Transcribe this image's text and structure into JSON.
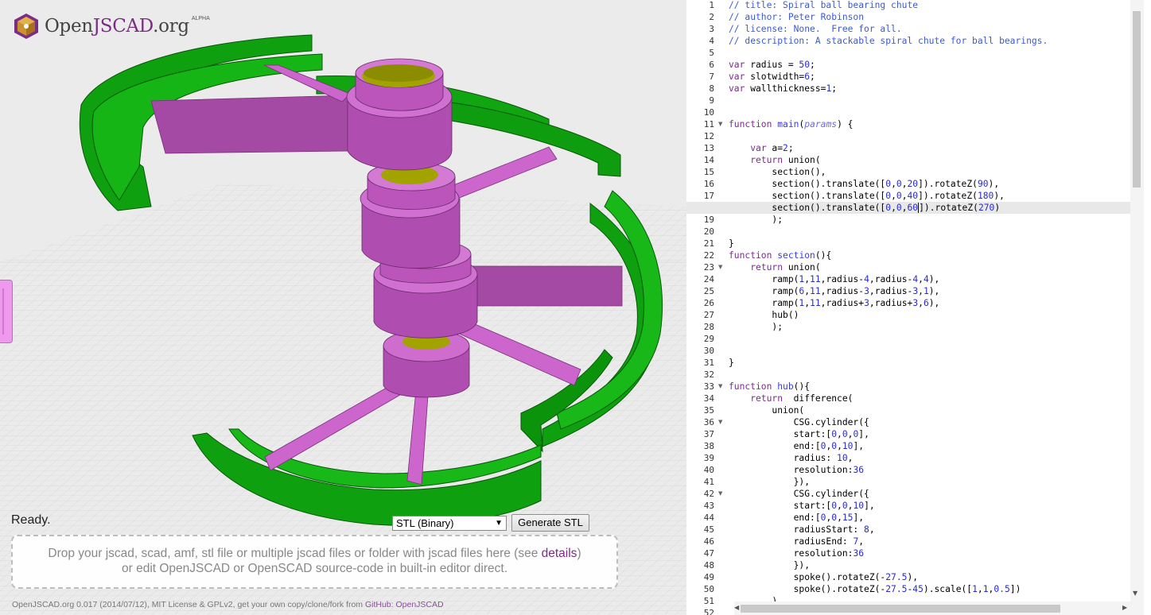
{
  "app": {
    "brand_open": "Open",
    "brand_accent": "JSCAD",
    "brand_tld": ".org",
    "badge": "ALPHA"
  },
  "viewport": {
    "status": "Ready.",
    "format_select": {
      "selected": "STL (Binary)"
    },
    "generate_button": "Generate STL",
    "dropzone": {
      "line1_before": "Drop your jscad, scad, amf, stl file or multiple jscad files or folder with jscad files here (see ",
      "line1_link": "details",
      "line1_after": ")",
      "line2": "or edit OpenJSCAD or OpenSCAD source-code in built-in editor direct."
    },
    "footer": {
      "text": "OpenJSCAD.org 0.017 (2014/07/12), MIT License & GPLv2, get your own copy/clone/fork from ",
      "link1": "GitHub: OpenJSCAD",
      "link_separator": ": "
    },
    "colors": {
      "ring": "#11a011",
      "spokes": "#cc66cc",
      "hub": "#b04db0",
      "bore": "#9b9b00",
      "grid": "#d6d6d6"
    }
  },
  "editor": {
    "active_line": 18,
    "folded_lines": [
      11,
      23,
      33,
      36,
      42
    ],
    "lines": [
      [
        [
          "cm",
          "// title: Spiral ball bearing chute"
        ]
      ],
      [
        [
          "cm",
          "// author: Peter Robinson"
        ]
      ],
      [
        [
          "cm",
          "// license: None.  Free for all."
        ]
      ],
      [
        [
          "cm",
          "// description: A stackable spiral chute for ball bearings."
        ]
      ],
      [],
      [
        [
          "kw",
          "var"
        ],
        [
          "t",
          " radius = "
        ],
        [
          "nm",
          "50"
        ],
        [
          "t",
          ";"
        ]
      ],
      [
        [
          "kw",
          "var"
        ],
        [
          "t",
          " slotwidth="
        ],
        [
          "nm",
          "6"
        ],
        [
          "t",
          ";"
        ]
      ],
      [
        [
          "kw",
          "var"
        ],
        [
          "t",
          " wallthickness="
        ],
        [
          "nm",
          "1"
        ],
        [
          "t",
          ";"
        ]
      ],
      [],
      [],
      [
        [
          "kw",
          "function"
        ],
        [
          "t",
          " "
        ],
        [
          "fn",
          "main"
        ],
        [
          "t",
          "("
        ],
        [
          "pr",
          "params"
        ],
        [
          "t",
          ") {"
        ]
      ],
      [],
      [
        [
          "t",
          "    "
        ],
        [
          "kw",
          "var"
        ],
        [
          "t",
          " a="
        ],
        [
          "nm",
          "2"
        ],
        [
          "t",
          ";"
        ]
      ],
      [
        [
          "t",
          "    "
        ],
        [
          "kw",
          "return"
        ],
        [
          "t",
          " union("
        ]
      ],
      [
        [
          "t",
          "        section(),"
        ]
      ],
      [
        [
          "t",
          "        section().translate(["
        ],
        [
          "nm",
          "0"
        ],
        [
          "t",
          ","
        ],
        [
          "nm",
          "0"
        ],
        [
          "t",
          ","
        ],
        [
          "nm",
          "20"
        ],
        [
          "t",
          "]).rotateZ("
        ],
        [
          "nm",
          "90"
        ],
        [
          "t",
          "),"
        ]
      ],
      [
        [
          "t",
          "        section().translate(["
        ],
        [
          "nm",
          "0"
        ],
        [
          "t",
          ","
        ],
        [
          "nm",
          "0"
        ],
        [
          "t",
          ","
        ],
        [
          "nm",
          "40"
        ],
        [
          "t",
          "]).rotateZ("
        ],
        [
          "nm",
          "180"
        ],
        [
          "t",
          "),"
        ]
      ],
      [
        [
          "t",
          "        section().translate(["
        ],
        [
          "nm",
          "0"
        ],
        [
          "t",
          ","
        ],
        [
          "nm",
          "0"
        ],
        [
          "t",
          ","
        ],
        [
          "nm",
          "60"
        ],
        [
          "c",
          ""
        ],
        [
          "t",
          "]).rotateZ("
        ],
        [
          "nm",
          "270"
        ],
        [
          "t",
          ")"
        ]
      ],
      [
        [
          "t",
          "        );"
        ]
      ],
      [],
      [
        [
          "t",
          "}"
        ]
      ],
      [
        [
          "kw",
          "function"
        ],
        [
          "t",
          " "
        ],
        [
          "fn",
          "section"
        ],
        [
          "t",
          "(){"
        ]
      ],
      [
        [
          "t",
          "    "
        ],
        [
          "kw",
          "return"
        ],
        [
          "t",
          " union("
        ]
      ],
      [
        [
          "t",
          "        ramp("
        ],
        [
          "nm",
          "1"
        ],
        [
          "t",
          ","
        ],
        [
          "nm",
          "11"
        ],
        [
          "t",
          ",radius-"
        ],
        [
          "nm",
          "4"
        ],
        [
          "t",
          ",radius-"
        ],
        [
          "nm",
          "4"
        ],
        [
          "t",
          ","
        ],
        [
          "nm",
          "4"
        ],
        [
          "t",
          "),"
        ]
      ],
      [
        [
          "t",
          "        ramp("
        ],
        [
          "nm",
          "6"
        ],
        [
          "t",
          ","
        ],
        [
          "nm",
          "11"
        ],
        [
          "t",
          ",radius-"
        ],
        [
          "nm",
          "3"
        ],
        [
          "t",
          ",radius-"
        ],
        [
          "nm",
          "3"
        ],
        [
          "t",
          ","
        ],
        [
          "nm",
          "1"
        ],
        [
          "t",
          "),"
        ]
      ],
      [
        [
          "t",
          "        ramp("
        ],
        [
          "nm",
          "1"
        ],
        [
          "t",
          ","
        ],
        [
          "nm",
          "11"
        ],
        [
          "t",
          ",radius+"
        ],
        [
          "nm",
          "3"
        ],
        [
          "t",
          ",radius+"
        ],
        [
          "nm",
          "3"
        ],
        [
          "t",
          ","
        ],
        [
          "nm",
          "6"
        ],
        [
          "t",
          "),"
        ]
      ],
      [
        [
          "t",
          "        hub()"
        ]
      ],
      [
        [
          "t",
          "        );"
        ]
      ],
      [],
      [],
      [
        [
          "t",
          "}"
        ]
      ],
      [],
      [
        [
          "kw",
          "function"
        ],
        [
          "t",
          " "
        ],
        [
          "fn",
          "hub"
        ],
        [
          "t",
          "(){"
        ]
      ],
      [
        [
          "t",
          "    "
        ],
        [
          "kw",
          "return"
        ],
        [
          "t",
          "  difference("
        ]
      ],
      [
        [
          "t",
          "        union("
        ]
      ],
      [
        [
          "t",
          "            CSG.cylinder({"
        ]
      ],
      [
        [
          "t",
          "            start:["
        ],
        [
          "nm",
          "0"
        ],
        [
          "t",
          ","
        ],
        [
          "nm",
          "0"
        ],
        [
          "t",
          ","
        ],
        [
          "nm",
          "0"
        ],
        [
          "t",
          "],"
        ]
      ],
      [
        [
          "t",
          "            end:["
        ],
        [
          "nm",
          "0"
        ],
        [
          "t",
          ","
        ],
        [
          "nm",
          "0"
        ],
        [
          "t",
          ","
        ],
        [
          "nm",
          "10"
        ],
        [
          "t",
          "],"
        ]
      ],
      [
        [
          "t",
          "            radius: "
        ],
        [
          "nm",
          "10"
        ],
        [
          "t",
          ","
        ]
      ],
      [
        [
          "t",
          "            resolution:"
        ],
        [
          "nm",
          "36"
        ]
      ],
      [
        [
          "t",
          "            }),"
        ]
      ],
      [
        [
          "t",
          "            CSG.cylinder({"
        ]
      ],
      [
        [
          "t",
          "            start:["
        ],
        [
          "nm",
          "0"
        ],
        [
          "t",
          ","
        ],
        [
          "nm",
          "0"
        ],
        [
          "t",
          ","
        ],
        [
          "nm",
          "10"
        ],
        [
          "t",
          "],"
        ]
      ],
      [
        [
          "t",
          "            end:["
        ],
        [
          "nm",
          "0"
        ],
        [
          "t",
          ","
        ],
        [
          "nm",
          "0"
        ],
        [
          "t",
          ","
        ],
        [
          "nm",
          "15"
        ],
        [
          "t",
          "],"
        ]
      ],
      [
        [
          "t",
          "            radiusStart: "
        ],
        [
          "nm",
          "8"
        ],
        [
          "t",
          ","
        ]
      ],
      [
        [
          "t",
          "            radiusEnd: "
        ],
        [
          "nm",
          "7"
        ],
        [
          "t",
          ","
        ]
      ],
      [
        [
          "t",
          "            resolution:"
        ],
        [
          "nm",
          "36"
        ]
      ],
      [
        [
          "t",
          "            }),"
        ]
      ],
      [
        [
          "t",
          "            spoke().rotateZ(-"
        ],
        [
          "nm",
          "27.5"
        ],
        [
          "t",
          "),"
        ]
      ],
      [
        [
          "t",
          "            spoke().rotateZ(-"
        ],
        [
          "nm",
          "27.5"
        ],
        [
          "t",
          "-"
        ],
        [
          "nm",
          "45"
        ],
        [
          "t",
          ").scale(["
        ],
        [
          "nm",
          "1"
        ],
        [
          "t",
          ","
        ],
        [
          "nm",
          "1"
        ],
        [
          "t",
          ","
        ],
        [
          "nm",
          "0.5"
        ],
        [
          "t",
          "])"
        ]
      ],
      [
        [
          "t",
          "        ),"
        ]
      ],
      [
        [
          "t",
          "        CSG.cylinder({"
        ]
      ]
    ]
  }
}
